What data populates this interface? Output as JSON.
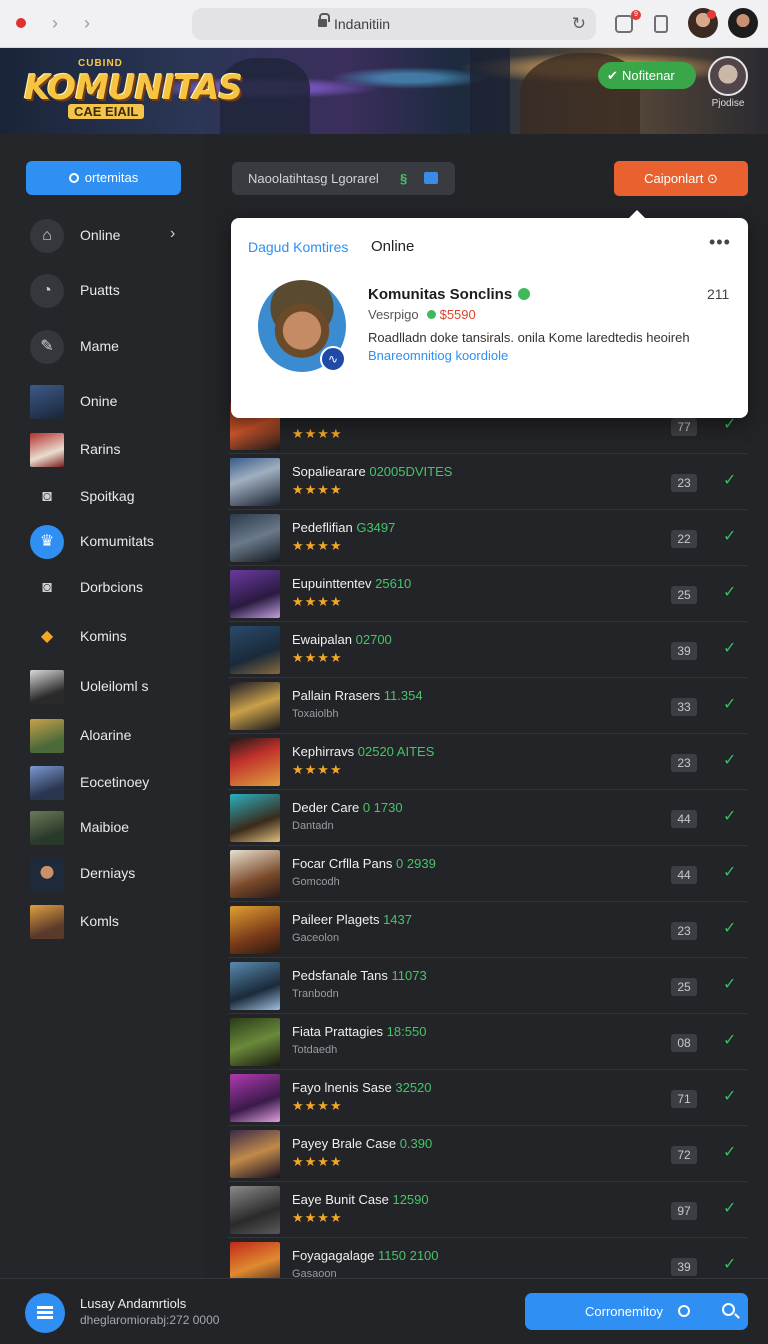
{
  "browser": {
    "url": "Indanitiin",
    "bag_badge": "9"
  },
  "banner": {
    "logo_top": "CUBIND",
    "logo_main": "KOMUNITAS",
    "logo_sub": "CAE EIAIL",
    "notif_label": "Nofitenar",
    "avatar_label": "Pjodise"
  },
  "sidebar": {
    "button_label": "ortemitas",
    "items": [
      {
        "label": "Online",
        "icon": "home-icon",
        "has_chevron": true
      },
      {
        "label": "Puatts",
        "icon": "chat-icon"
      },
      {
        "label": "Mame",
        "icon": "brush-icon"
      },
      {
        "label": "Onine",
        "icon": "game-thumb"
      },
      {
        "label": "Rarins",
        "icon": "game-thumb"
      },
      {
        "label": "Spoitkag",
        "icon": "camera-icon"
      },
      {
        "label": "Komumitats",
        "icon": "community-icon",
        "active": true
      },
      {
        "label": "Dorbcions",
        "icon": "camera-icon"
      },
      {
        "label": "Komins",
        "icon": "badge-icon"
      },
      {
        "label": "Uoleiloml s",
        "icon": "game-thumb"
      },
      {
        "label": "Aloarine",
        "icon": "game-thumb"
      },
      {
        "label": "Eocetinoey",
        "icon": "game-thumb"
      },
      {
        "label": "Maibioe",
        "icon": "game-thumb"
      },
      {
        "label": "Derniays",
        "icon": "game-thumb"
      },
      {
        "label": "Komls",
        "icon": "game-thumb"
      }
    ]
  },
  "content": {
    "search_text": "Naoolatihtasg Lgorarel",
    "cta_label": "Caiponlart"
  },
  "popup": {
    "tab_label": "Dagud Komtires",
    "tab_active": "Online",
    "name": "Komunitas Sonclins",
    "number": "211",
    "meta": "Vesrpigo",
    "price": "$5590",
    "description": "Roadlladn doke tansirals. onila Kome laredtedis heoireh",
    "link": "Bnareomnitiog koordiole"
  },
  "games": [
    {
      "title": "",
      "num": "",
      "sub": "",
      "stars": true,
      "count": "77"
    },
    {
      "title": "Sopaliearare",
      "num": "02005DVITES",
      "sub": "",
      "stars": true,
      "count": "23"
    },
    {
      "title": "Pedeflifian",
      "num": "G3497",
      "sub": "",
      "stars": true,
      "count": "22"
    },
    {
      "title": "Eupuinttentev",
      "num": "25610",
      "sub": "",
      "stars": true,
      "count": "25"
    },
    {
      "title": "Ewaipalan",
      "num": "02700",
      "sub": "",
      "stars": true,
      "count": "39"
    },
    {
      "title": "Pallain Rrasers",
      "num": "11.354",
      "sub": "Toxaiolbh",
      "stars": false,
      "count": "33"
    },
    {
      "title": "Kephirravs",
      "num": "02520 AITES",
      "sub": "",
      "stars": true,
      "count": "23"
    },
    {
      "title": "Deder Care",
      "num": "0 1730",
      "sub": "Dantadn",
      "stars": false,
      "count": "44"
    },
    {
      "title": "Focar Crflla Pans",
      "num": "0 2939",
      "sub": "Gomcodh",
      "stars": false,
      "count": "44"
    },
    {
      "title": "Paileer Plagets",
      "num": "1437",
      "sub": "Gaceolon",
      "stars": false,
      "count": "23"
    },
    {
      "title": "Pedsfanale Tans",
      "num": "11073",
      "sub": "Tranbodn",
      "stars": false,
      "count": "25"
    },
    {
      "title": "Fiata Prattagies",
      "num": "18:550",
      "sub": "Totdaedh",
      "stars": false,
      "count": "08"
    },
    {
      "title": "Fayo lnenis Sase",
      "num": "32520",
      "sub": "",
      "stars": true,
      "count": "71"
    },
    {
      "title": "Payey Brale Case",
      "num": "0.390",
      "sub": "",
      "stars": true,
      "count": "72"
    },
    {
      "title": "Eaye Bunit Case",
      "num": "12590",
      "sub": "",
      "stars": true,
      "count": "97"
    },
    {
      "title": "Foyagagalage",
      "num": "1150 2100",
      "sub": "Gasaoon",
      "stars": false,
      "count": "39"
    }
  ],
  "bottombar": {
    "title": "Lusay Andamrtiols",
    "subtitle": "dheglaromiorabj:272 0000",
    "button_label": "Corronemitoy"
  }
}
